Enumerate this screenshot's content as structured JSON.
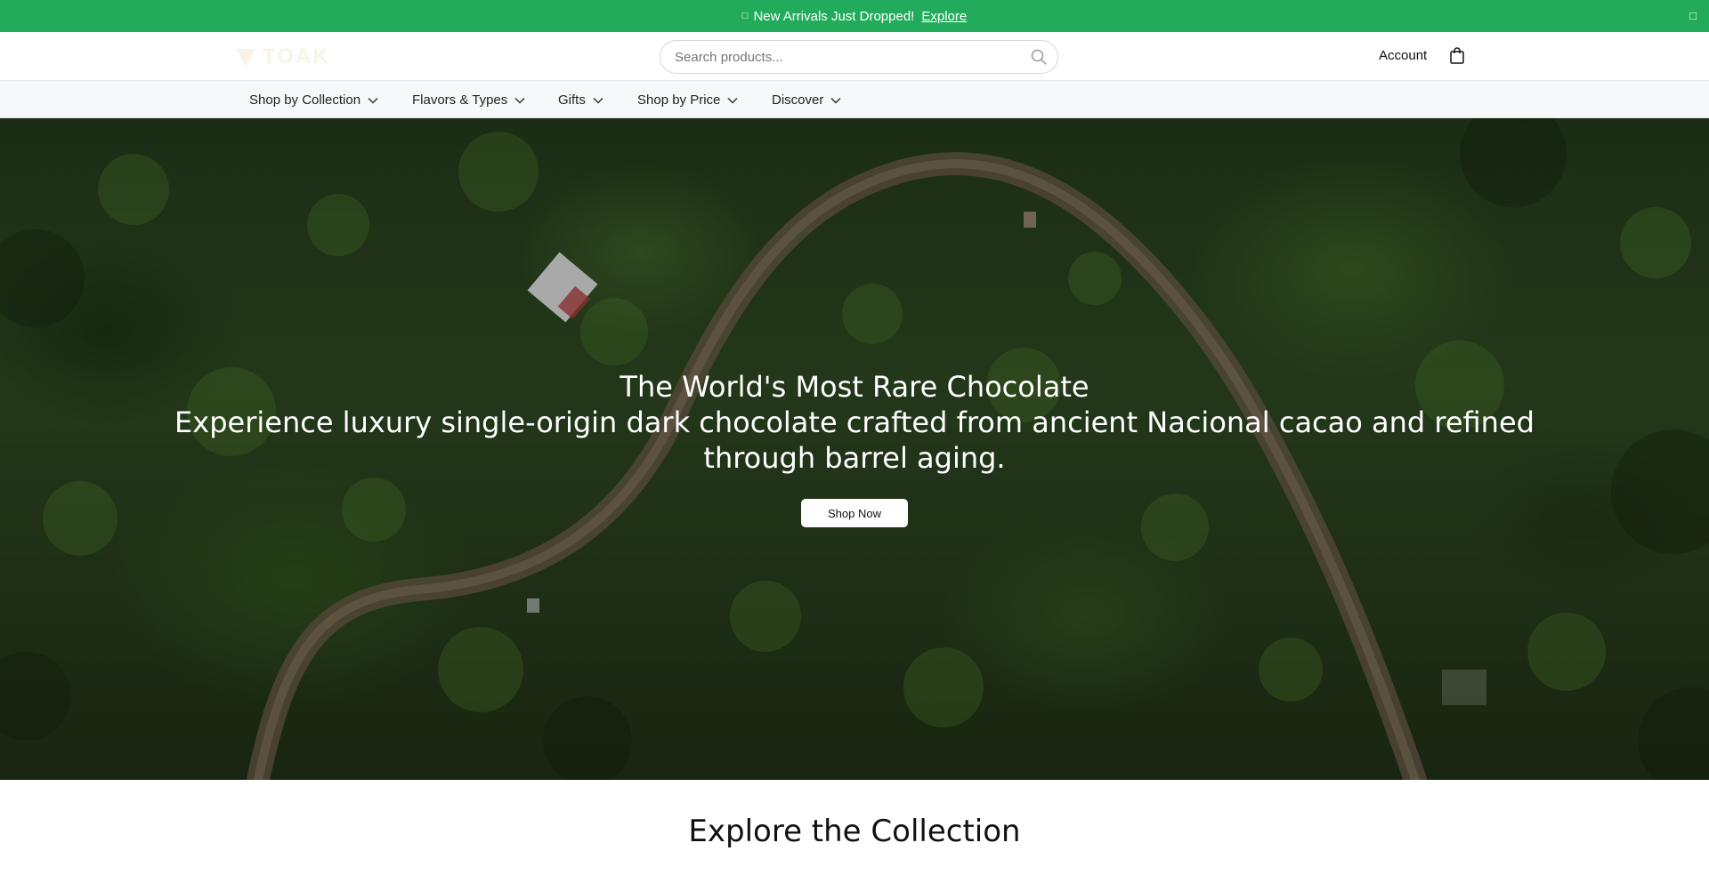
{
  "announcement": {
    "message": "New Arrivals Just Dropped!",
    "link": "Explore",
    "gift_icon": "gift-icon",
    "close_icon": "close-icon",
    "background": "#22ab5a"
  },
  "header": {
    "logo_text": "TOAK",
    "search": {
      "placeholder": "Search products..."
    },
    "account_label": "Account",
    "cart_icon": "shopping-bag-icon"
  },
  "nav": {
    "items": [
      {
        "label": "Shop by Collection"
      },
      {
        "label": "Flavors & Types"
      },
      {
        "label": "Gifts"
      },
      {
        "label": "Shop by Price"
      },
      {
        "label": "Discover"
      }
    ]
  },
  "hero": {
    "title": "The World's Most Rare Chocolate",
    "subtitle": "Experience luxury single-origin dark chocolate crafted from ancient Nacional cacao and refined through barrel aging.",
    "cta_label": "Shop Now"
  },
  "explore": {
    "heading": "Explore the Collection"
  }
}
